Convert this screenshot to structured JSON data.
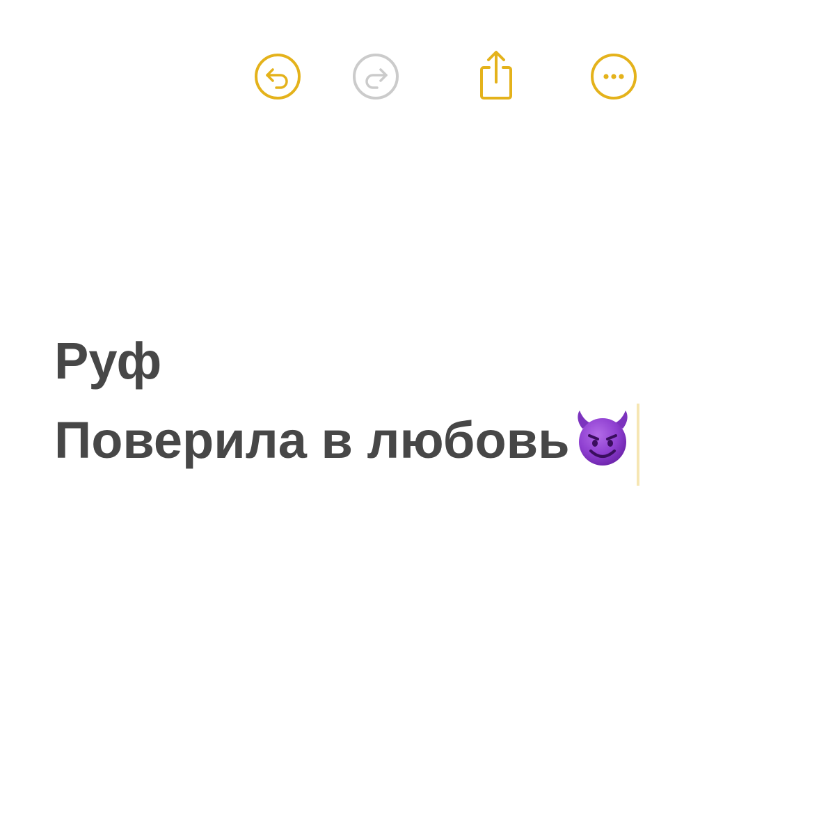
{
  "toolbar": {
    "buttons": [
      {
        "name": "undo",
        "icon": "undo-icon",
        "enabled": true
      },
      {
        "name": "redo",
        "icon": "redo-icon",
        "enabled": false
      },
      {
        "name": "share",
        "icon": "share-icon",
        "enabled": true
      },
      {
        "name": "more",
        "icon": "more-icon",
        "enabled": true
      }
    ],
    "accent_color": "#E4B21B",
    "disabled_color": "#CBCBCB"
  },
  "note": {
    "title": "Руф",
    "body_line": "Поверила в любовь",
    "emoji": "smiling-devil-emoji",
    "text_color": "#474747",
    "caret_color": "#F6E6B3"
  }
}
